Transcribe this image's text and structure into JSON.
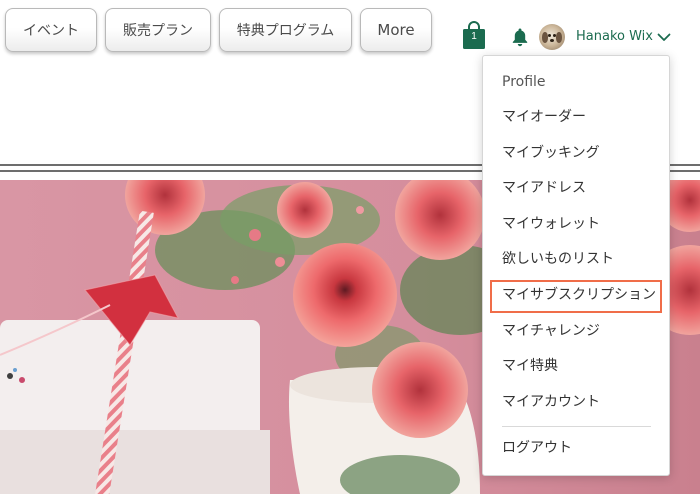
{
  "nav": {
    "items": [
      {
        "label": "イベント"
      },
      {
        "label": "販売プラン"
      },
      {
        "label": "特典プログラム"
      },
      {
        "label": "More"
      }
    ]
  },
  "header": {
    "cart_count": "1",
    "user_name": "Hanako Wix",
    "icons": {
      "cart": "shopping-bag-icon",
      "bell": "bell-icon",
      "chevron": "chevron-down-icon"
    }
  },
  "menu": {
    "items": [
      {
        "label": "Profile"
      },
      {
        "label": "マイオーダー"
      },
      {
        "label": "マイブッキング"
      },
      {
        "label": "マイアドレス"
      },
      {
        "label": "マイウォレット"
      },
      {
        "label": "欲しいものリスト"
      },
      {
        "label": "マイサブスクリプション",
        "highlighted": true
      },
      {
        "label": "マイチャレンジ"
      },
      {
        "label": "マイ特典"
      },
      {
        "label": "マイアカウント"
      }
    ],
    "logout_label": "ログアウト"
  },
  "colors": {
    "accent_green": "#1b6b4f",
    "highlight_orange": "#f06d49"
  }
}
